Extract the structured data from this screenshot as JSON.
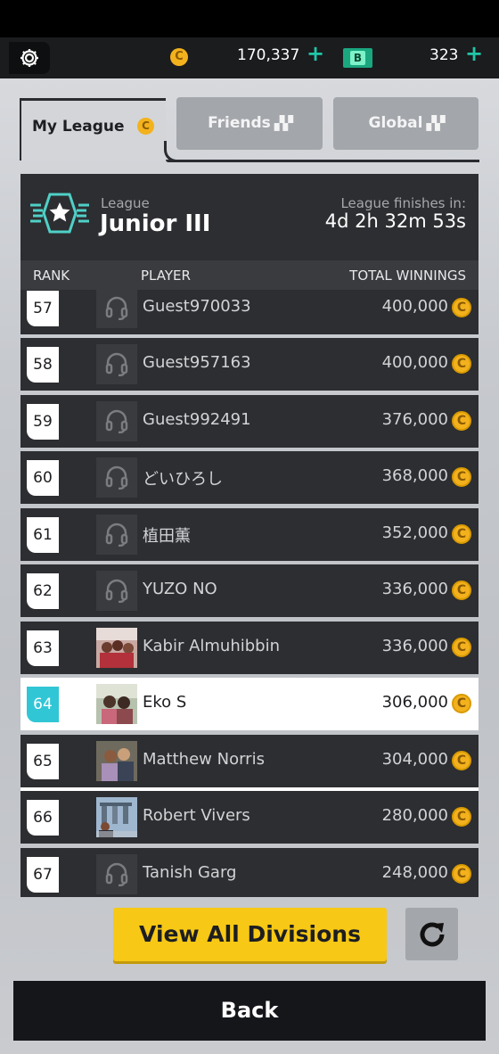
{
  "topbar": {
    "coin_symbol": "C",
    "coins": "170,337",
    "coins_plus": "+",
    "bucks_symbol": "B",
    "bucks": "323",
    "bucks_plus": "+"
  },
  "tabs": [
    {
      "label": "My League",
      "active": true
    },
    {
      "label": "Friends",
      "active": false
    },
    {
      "label": "Global",
      "active": false
    }
  ],
  "league": {
    "small_label": "League",
    "name": "Junior III",
    "finish_label": "League finishes in:",
    "finish_time": "4d 2h 32m 53s"
  },
  "columns": {
    "rank": "RANK",
    "player": "PLAYER",
    "winnings": "TOTAL WINNINGS"
  },
  "rows": [
    {
      "rank": "57",
      "name": "Guest970033",
      "amount": "400,000"
    },
    {
      "rank": "58",
      "name": "Guest957163",
      "amount": "400,000"
    },
    {
      "rank": "59",
      "name": "Guest992491",
      "amount": "376,000"
    },
    {
      "rank": "60",
      "name": "どいひろし",
      "amount": "368,000"
    },
    {
      "rank": "61",
      "name": "植田薫",
      "amount": "352,000"
    },
    {
      "rank": "62",
      "name": "YUZO NO",
      "amount": "336,000"
    },
    {
      "rank": "63",
      "name": "Kabir Almuhibbin",
      "amount": "336,000"
    },
    {
      "rank": "64",
      "name": "Eko S",
      "amount": "306,000"
    },
    {
      "rank": "65",
      "name": "Matthew Norris",
      "amount": "304,000"
    },
    {
      "rank": "66",
      "name": "Robert Vivers",
      "amount": "280,000"
    },
    {
      "rank": "67",
      "name": "Tanish Garg",
      "amount": "248,000"
    }
  ],
  "buttons": {
    "view_all": "View All Divisions",
    "back": "Back"
  },
  "colors": {
    "accent_coin": "#f3b21d",
    "highlight_rank": "#30c6d6",
    "primary_button": "#f7c815",
    "plus_green": "#1fc7a8"
  }
}
